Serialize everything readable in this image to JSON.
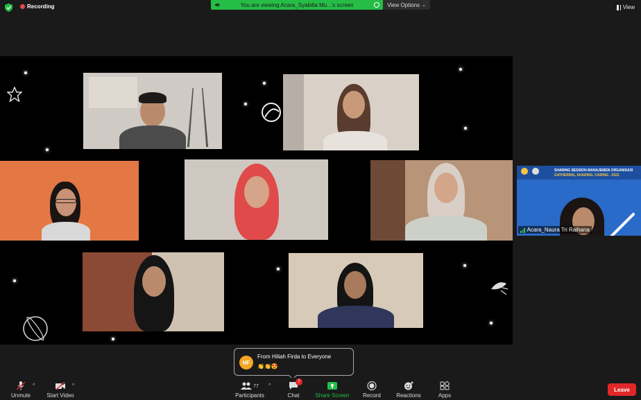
{
  "topbar": {
    "recording_label": "Recording",
    "viewing_banner": "You are viewing Acara_Syabilla Mu...'s screen",
    "view_options_label": "View Options",
    "view_label": "View"
  },
  "shared_screen": {
    "participants": [
      {
        "id": "p1",
        "bg": "#cfcac4",
        "skin": "#b98a6c",
        "hair": "#1e1a18",
        "clothes": "#4b4b4b"
      },
      {
        "id": "p2",
        "bg": "#d9d1c8",
        "skin": "#c89a7a",
        "hair": "#5a3c2e",
        "clothes": "#e8e2dc"
      },
      {
        "id": "p3",
        "bg": "#e37845",
        "skin": "#c79276",
        "hair": "#1a1412",
        "clothes": "#d8d8d8"
      },
      {
        "id": "p4",
        "bg": "#cfc8c0",
        "skin": "#d6a488",
        "hair": "#e04a4a",
        "clothes": "#e04a4a"
      },
      {
        "id": "p5",
        "bg": "#b89478",
        "skin": "#d3a68a",
        "hair": "#d9cfc6",
        "clothes": "#cdd0c8"
      },
      {
        "id": "p6",
        "bg": "#8a4a36",
        "skin": "#b98a6c",
        "hair": "#151515",
        "clothes": "#2a2a2a"
      },
      {
        "id": "p7",
        "bg": "#d7cab8",
        "skin": "#a9795b",
        "hair": "#141414",
        "clothes": "#30375a"
      }
    ]
  },
  "side_video": {
    "banner_line1": "SHARING SESSION MANAJEMEN ORGANISASI",
    "banner_line2": "GATHERING, SHARING, CARING - 2022",
    "name": "Acara_Naura Tri Raihana"
  },
  "chat_popup": {
    "initials": "HF",
    "from": "From Hiliah Firda to Everyone",
    "message": "👏👏😍"
  },
  "toolbar": {
    "unmute": "Unmute",
    "start_video": "Start Video",
    "participants": "Participants",
    "participants_count": "77",
    "chat": "Chat",
    "chat_badge": "7",
    "share_screen": "Share Screen",
    "record": "Record",
    "reactions": "Reactions",
    "apps": "Apps",
    "leave": "Leave"
  },
  "colors": {
    "accent_green": "#26bd47",
    "leave_red": "#e02828",
    "recording_red": "#e8474f"
  }
}
